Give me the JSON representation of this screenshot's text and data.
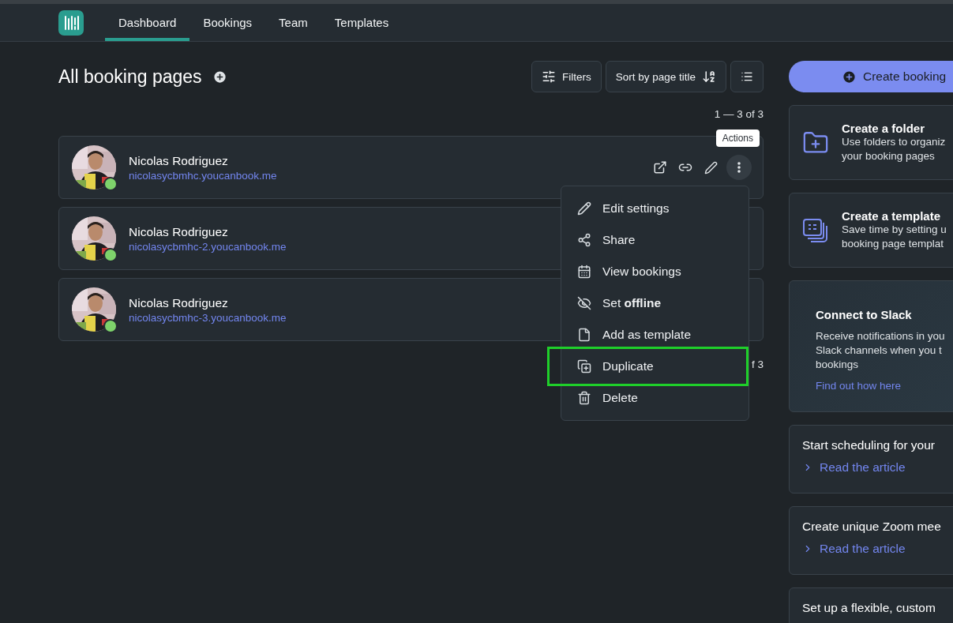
{
  "nav": {
    "tabs": [
      {
        "label": "Dashboard",
        "selected": true
      },
      {
        "label": "Bookings",
        "selected": false
      },
      {
        "label": "Team",
        "selected": false
      },
      {
        "label": "Templates",
        "selected": false
      }
    ]
  },
  "main": {
    "title": "All booking pages",
    "filters_label": "Filters",
    "sort_label": "Sort by page title",
    "pagination": "1 — 3 of 3",
    "pagination_bottom": "f 3",
    "pages": [
      {
        "name": "Nicolas Rodriguez",
        "url": "nicolasycbmhc.youcanbook.me",
        "online": true,
        "actions_visible": true
      },
      {
        "name": "Nicolas Rodriguez",
        "url": "nicolasycbmhc-2.youcanbook.me",
        "online": true,
        "actions_visible": false
      },
      {
        "name": "Nicolas Rodriguez",
        "url": "nicolasycbmhc-3.youcanbook.me",
        "online": true,
        "actions_visible": false
      }
    ],
    "tooltip": "Actions",
    "actions_menu": [
      {
        "label": "Edit settings",
        "highlighted": false
      },
      {
        "label": "Share",
        "highlighted": false
      },
      {
        "label": "View bookings",
        "highlighted": false
      },
      {
        "label": "Set **offline**",
        "highlighted": false
      },
      {
        "label": "Add as template",
        "highlighted": false
      },
      {
        "label": "Duplicate",
        "highlighted": true
      },
      {
        "label": "Delete",
        "highlighted": false
      }
    ]
  },
  "sidebar": {
    "create_button": "Create booking",
    "cards": [
      {
        "kind": "folder",
        "title": "Create a folder",
        "lines": [
          "Use folders to organiz",
          "your booking pages"
        ]
      },
      {
        "kind": "template",
        "title": "Create a template",
        "lines": [
          "Save time by setting u",
          "booking page templat"
        ]
      },
      {
        "kind": "promo",
        "title": "Connect to Slack",
        "lines": [
          "Receive notifications in you",
          "Slack channels when you t",
          "bookings"
        ],
        "link": "Find out how here"
      },
      {
        "kind": "article",
        "title": "Start scheduling for your",
        "link": "Read the article"
      },
      {
        "kind": "article",
        "title": "Create unique Zoom mee",
        "link": "Read the article"
      },
      {
        "kind": "article",
        "title": "Set up a flexible, custom"
      }
    ]
  }
}
